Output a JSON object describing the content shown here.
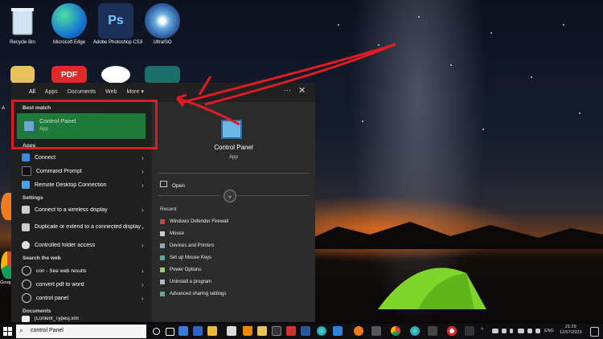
{
  "desktop": {
    "icons": [
      {
        "label": "Recycle Bin",
        "icon": "recycle-bin-icon"
      },
      {
        "label": "Microsoft Edge",
        "icon": "edge-icon"
      },
      {
        "label": "Adobe Photoshop CS3",
        "icon": "photoshop-icon",
        "glyph": "Ps"
      },
      {
        "label": "UltraISO",
        "icon": "ultraiso-icon"
      }
    ],
    "row2_glyphs": {
      "pdf": "PDF"
    },
    "partial_labels": {
      "left_a": "A",
      "left_ad": "Ad",
      "google": "Goog"
    }
  },
  "search": {
    "tabs": [
      "All",
      "Apps",
      "Documents",
      "Web",
      "More ▾"
    ],
    "more_icon": "···",
    "close_icon": "✕",
    "best_match_header": "Best match",
    "best_match": {
      "title": "Control Panel",
      "subtitle": "App"
    },
    "apps_header": "Apps",
    "apps": [
      "Connect",
      "Command Prompt",
      "Remote Desktop Connection"
    ],
    "settings_header": "Settings",
    "settings": [
      "Connect to a wireless display",
      "Duplicate or extend to a connected display",
      "Controlled folder access"
    ],
    "web_header": "Search the web",
    "web": [
      {
        "text": "con - See web results"
      },
      {
        "text": "convert pdf to word"
      },
      {
        "text": "control panel"
      }
    ],
    "documents_header": "Documents",
    "documents_partial": "[Content_Types].xml"
  },
  "detail": {
    "title": "Control Panel",
    "subtitle": "App",
    "open_label": "Open",
    "expand_icon": "⌄",
    "recent_header": "Recent",
    "recent": [
      "Windows Defender Firewall",
      "Mouse",
      "Devices and Printers",
      "Set up Mouse Keys",
      "Power Options",
      "Uninstall a program",
      "Advanced sharing settings"
    ]
  },
  "taskbar": {
    "search_value": "control Panel",
    "language": "ENG",
    "time": "21:29",
    "date": "12/07/2023"
  },
  "colors": {
    "annotation": "#e01b24",
    "best_match": "#1e8a3e",
    "panel": "#202020"
  }
}
